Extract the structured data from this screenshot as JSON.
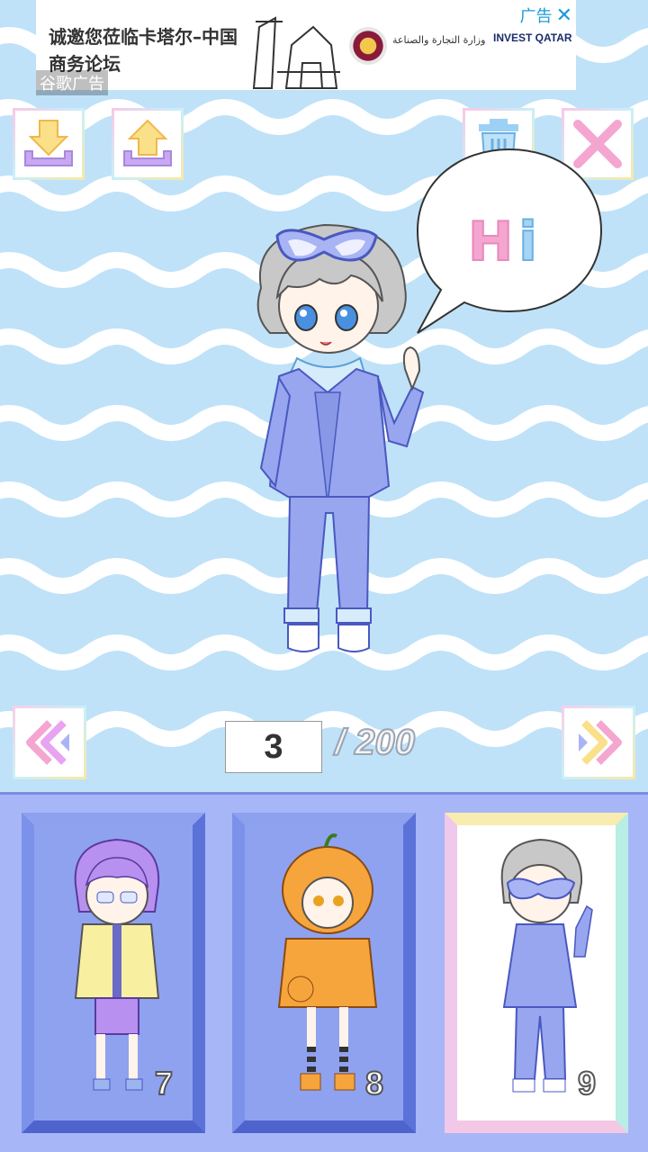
{
  "ad": {
    "text": "诚邀您莅临卡塔尔–中国商务论坛",
    "label": "谷歌广告",
    "tag": "广告",
    "close": "✕",
    "arabic": "وزارة التجارة والصناعة",
    "invest": "INVEST QATAR"
  },
  "toolbar": {
    "download_icon": "download-icon",
    "upload_icon": "upload-icon",
    "trash_icon": "trash-icon",
    "close_icon": "close-icon"
  },
  "speech": {
    "h": "H",
    "i": "i"
  },
  "pager": {
    "current": "3",
    "total": "/ 200"
  },
  "slots": [
    {
      "number": "7",
      "theme": "purple-hair-hoodie"
    },
    {
      "number": "8",
      "theme": "pumpkin-costume"
    },
    {
      "number": "9",
      "theme": "denim-outfit"
    }
  ],
  "colors": {
    "background": "#bfe2f8",
    "panel": "#a7b6f6",
    "accent_pink": "#f4a6d0",
    "accent_blue": "#a6d4f4"
  }
}
